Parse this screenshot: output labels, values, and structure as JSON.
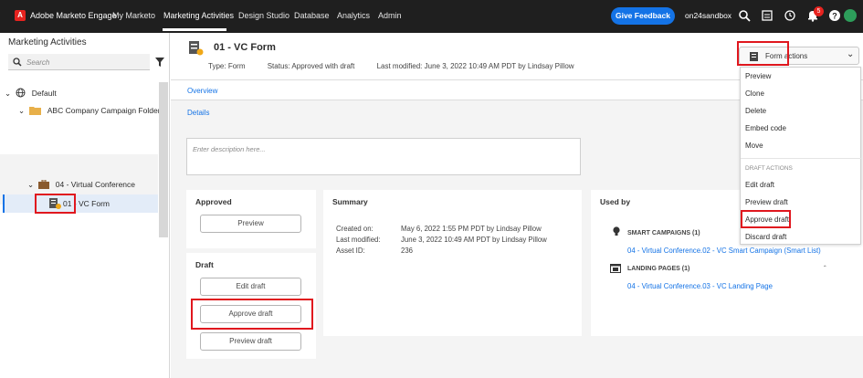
{
  "topbar": {
    "brand": "Adobe Marketo Engage",
    "nav": [
      "My Marketo",
      "Marketing Activities",
      "Design Studio",
      "Database",
      "Analytics",
      "Admin"
    ],
    "feedback": "Give Feedback",
    "tenant": "on24sandbox",
    "notification_count": "5"
  },
  "left": {
    "title": "Marketing Activities",
    "search_placeholder": "Search",
    "tree": {
      "default": "Default",
      "folder": "ABC Company Campaign Folder",
      "program": "04 - Virtual Conference",
      "asset": "01 - VC Form"
    }
  },
  "header": {
    "title": "01 - VC Form",
    "type_label": "Type:",
    "type": "Form",
    "status_label": "Status:",
    "status": "Approved with draft",
    "modified_label": "Last modified:",
    "modified": "June 3, 2022 10:49 AM PDT by Lindsay Pillow"
  },
  "tabs": {
    "overview": "Overview",
    "details": "Details"
  },
  "description_placeholder": "Enter description here...",
  "approved": {
    "title": "Approved",
    "preview": "Preview"
  },
  "draft": {
    "title": "Draft",
    "edit": "Edit draft",
    "approve": "Approve draft",
    "preview": "Preview draft"
  },
  "summary": {
    "title": "Summary",
    "created_label": "Created on:",
    "created": "May 6, 2022 1:55 PM PDT by Lindsay Pillow",
    "modified_label": "Last modified:",
    "modified": "June 3, 2022 10:49 AM PDT by Lindsay Pillow",
    "asset_id_label": "Asset ID:",
    "asset_id": "236"
  },
  "used_by": {
    "title": "Used by",
    "smart_campaigns": "SMART CAMPAIGNS (1)",
    "smart_campaign_link": "04 - Virtual Conference.02 - VC Smart Campaign (Smart List)",
    "landing_pages": "LANDING PAGES (1)",
    "landing_page_link": "04 - Virtual Conference.03 - VC Landing Page"
  },
  "form_actions": {
    "label": "Form actions",
    "items": [
      "Preview",
      "Clone",
      "Delete",
      "Embed code",
      "Move"
    ],
    "draft_section": "DRAFT ACTIONS",
    "draft_items": [
      "Edit draft",
      "Preview draft",
      "Approve draft",
      "Discard draft"
    ]
  },
  "colors": {
    "accent": "#1473e6",
    "highlight": "#e0171e",
    "topbar": "#1f1f1f"
  }
}
